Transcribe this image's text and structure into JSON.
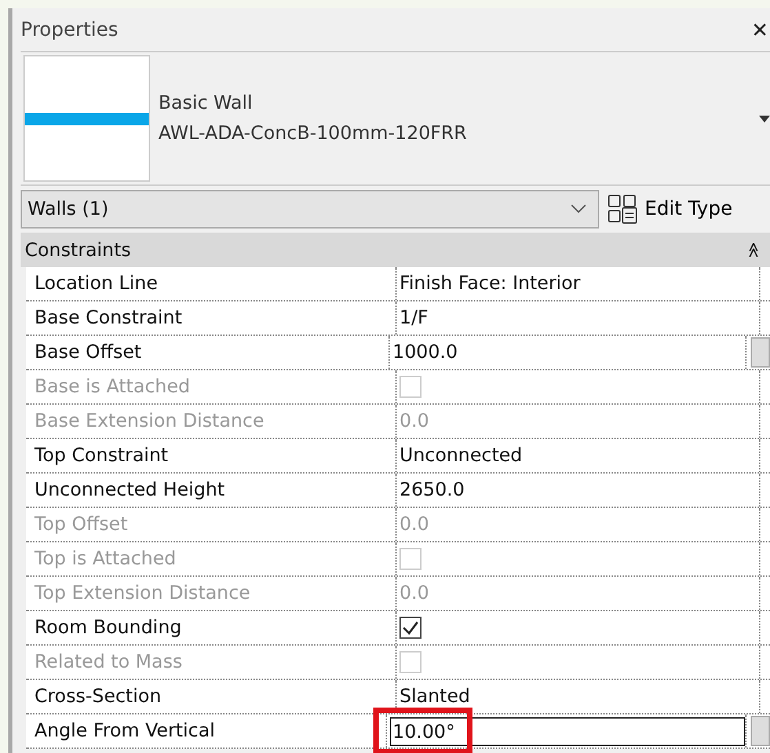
{
  "panel": {
    "title": "Properties",
    "close": "✕"
  },
  "type_selector": {
    "family": "Basic Wall",
    "type": "AWL-ADA-ConcB-100mm-120FRR"
  },
  "filter": {
    "value": "Walls (1)",
    "edit_type": "Edit Type"
  },
  "group": {
    "title": "Constraints",
    "collapse": "≫",
    "expanded": true
  },
  "rows": [
    {
      "label": "Location Line",
      "kind": "text",
      "value": "Finish Face: Interior",
      "disabled": false,
      "button": false,
      "editing": false,
      "highlighted": false
    },
    {
      "label": "Base Constraint",
      "kind": "text",
      "value": "1/F",
      "disabled": false,
      "button": false,
      "editing": false,
      "highlighted": false
    },
    {
      "label": "Base Offset",
      "kind": "text",
      "value": "1000.0",
      "disabled": false,
      "button": true,
      "editing": false,
      "highlighted": false
    },
    {
      "label": "Base is Attached",
      "kind": "checkbox",
      "checked": false,
      "disabled": true,
      "button": false,
      "editing": false,
      "highlighted": false
    },
    {
      "label": "Base Extension Distance",
      "kind": "text",
      "value": "0.0",
      "disabled": true,
      "button": false,
      "editing": false,
      "highlighted": false
    },
    {
      "label": "Top Constraint",
      "kind": "text",
      "value": "Unconnected",
      "disabled": false,
      "button": false,
      "editing": false,
      "highlighted": false
    },
    {
      "label": "Unconnected Height",
      "kind": "text",
      "value": "2650.0",
      "disabled": false,
      "button": false,
      "editing": false,
      "highlighted": false
    },
    {
      "label": "Top Offset",
      "kind": "text",
      "value": "0.0",
      "disabled": true,
      "button": false,
      "editing": false,
      "highlighted": false
    },
    {
      "label": "Top is Attached",
      "kind": "checkbox",
      "checked": false,
      "disabled": true,
      "button": false,
      "editing": false,
      "highlighted": false
    },
    {
      "label": "Top Extension Distance",
      "kind": "text",
      "value": "0.0",
      "disabled": true,
      "button": false,
      "editing": false,
      "highlighted": false
    },
    {
      "label": "Room Bounding",
      "kind": "checkbox",
      "checked": true,
      "disabled": false,
      "button": false,
      "editing": false,
      "highlighted": false
    },
    {
      "label": "Related to Mass",
      "kind": "checkbox",
      "checked": false,
      "disabled": true,
      "button": false,
      "editing": false,
      "highlighted": false
    },
    {
      "label": "Cross-Section",
      "kind": "text",
      "value": "Slanted",
      "disabled": false,
      "button": false,
      "editing": false,
      "highlighted": false
    },
    {
      "label": "Angle From Vertical",
      "kind": "text",
      "value": "10.00°",
      "disabled": false,
      "button": true,
      "editing": true,
      "highlighted": true
    }
  ]
}
